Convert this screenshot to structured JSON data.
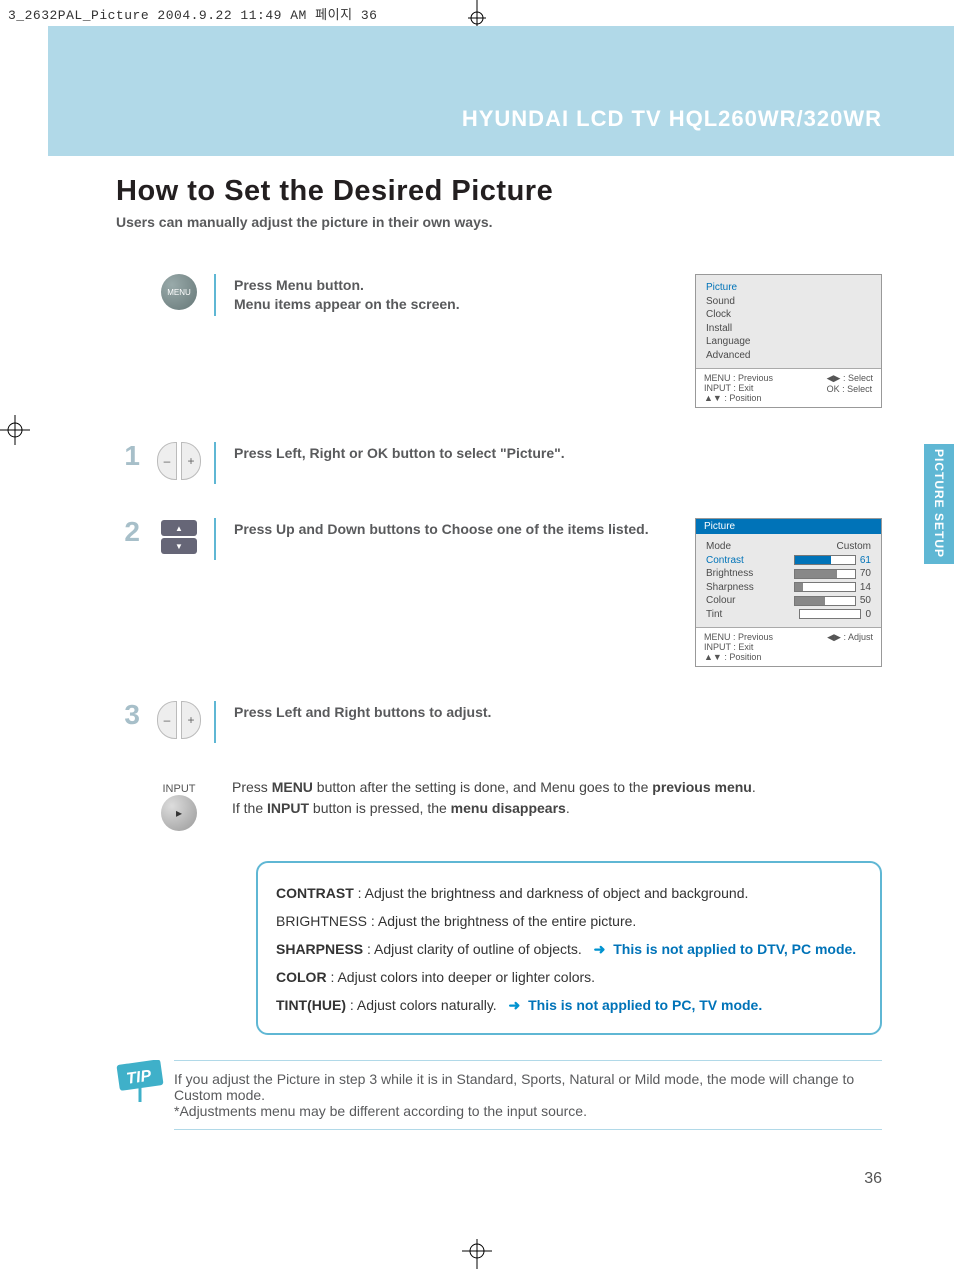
{
  "header_crop_text": "3_2632PAL_Picture  2004.9.22 11:49 AM  페이지 36",
  "header_title": "HYUNDAI LCD TV HQL260WR/320WR",
  "side_tab": "PICTURE SETUP",
  "page_title": "How to Set the Desired Picture",
  "subtitle": "Users can manually adjust the picture in their own ways.",
  "menu_btn": "MENU",
  "input_label": "INPUT",
  "steps": {
    "menu": {
      "line1": "Press Menu button.",
      "line2": "Menu items appear on the screen."
    },
    "s1": "Press Left, Right or OK button to select \"Picture\".",
    "s2": "Press Up and Down buttons to Choose one of the items listed.",
    "s3": "Press Left and Right buttons to adjust."
  },
  "nums": {
    "n1": "1",
    "n2": "2",
    "n3": "3"
  },
  "final": {
    "part1": "Press ",
    "b1": "MENU",
    "part2": " button after the setting is done, and Menu goes to the ",
    "b2": "previous menu",
    "part3": ".",
    "part4": "If the ",
    "b3": "INPUT",
    "part5": " button is pressed, the ",
    "b4": "menu disappears",
    "part6": "."
  },
  "osd1": {
    "items": [
      "Picture",
      "Sound",
      "Clock",
      "Install",
      "Language",
      "Advanced"
    ],
    "foot": {
      "menu": "MENU : Previous",
      "input": "INPUT : Exit",
      "pos": "▲▼ : Position",
      "sel1": "◀▶ : Select",
      "sel2": "OK : Select"
    }
  },
  "osd2": {
    "title": "Picture",
    "rows": [
      {
        "label": "Mode",
        "value": "Custom",
        "bar": null,
        "sel": false
      },
      {
        "label": "Contrast",
        "value": "61",
        "bar": 61,
        "sel": true
      },
      {
        "label": "Brightness",
        "value": "70",
        "bar": 70,
        "sel": false
      },
      {
        "label": "Sharpness",
        "value": "14",
        "bar": 14,
        "sel": false
      },
      {
        "label": "Colour",
        "value": "50",
        "bar": 50,
        "sel": false
      },
      {
        "label": "Tint",
        "value": "0",
        "bar": 0,
        "sel": false
      }
    ],
    "foot": {
      "menu": "MENU : Previous",
      "input": "INPUT : Exit",
      "pos": "▲▼ : Position",
      "adj": "◀▶ : Adjust"
    }
  },
  "desc": {
    "l1a": "CONTRAST",
    "l1b": " : Adjust the brightness and darkness of object and background.",
    "l2": "BRIGHTNESS : Adjust the brightness of the entire picture.",
    "l3a": "SHARPNESS",
    "l3b": " : Adjust clarity of outline of objects.",
    "l3c": "This is not applied to DTV, PC mode.",
    "l4a": "COLOR",
    "l4b": " : Adjust colors into deeper or lighter colors.",
    "l5a": "TINT(HUE)",
    "l5b": " : Adjust colors naturally.",
    "l5c": "This is not applied to PC, TV mode."
  },
  "tip_label": "TIP",
  "tip_text": "If you adjust the Picture in step 3 while it is in Standard, Sports, Natural or Mild mode, the mode will change to Custom mode.",
  "tip_note": "*Adjustments menu may be different according to the input source.",
  "page_number": "36",
  "arrow_marker": "➜"
}
